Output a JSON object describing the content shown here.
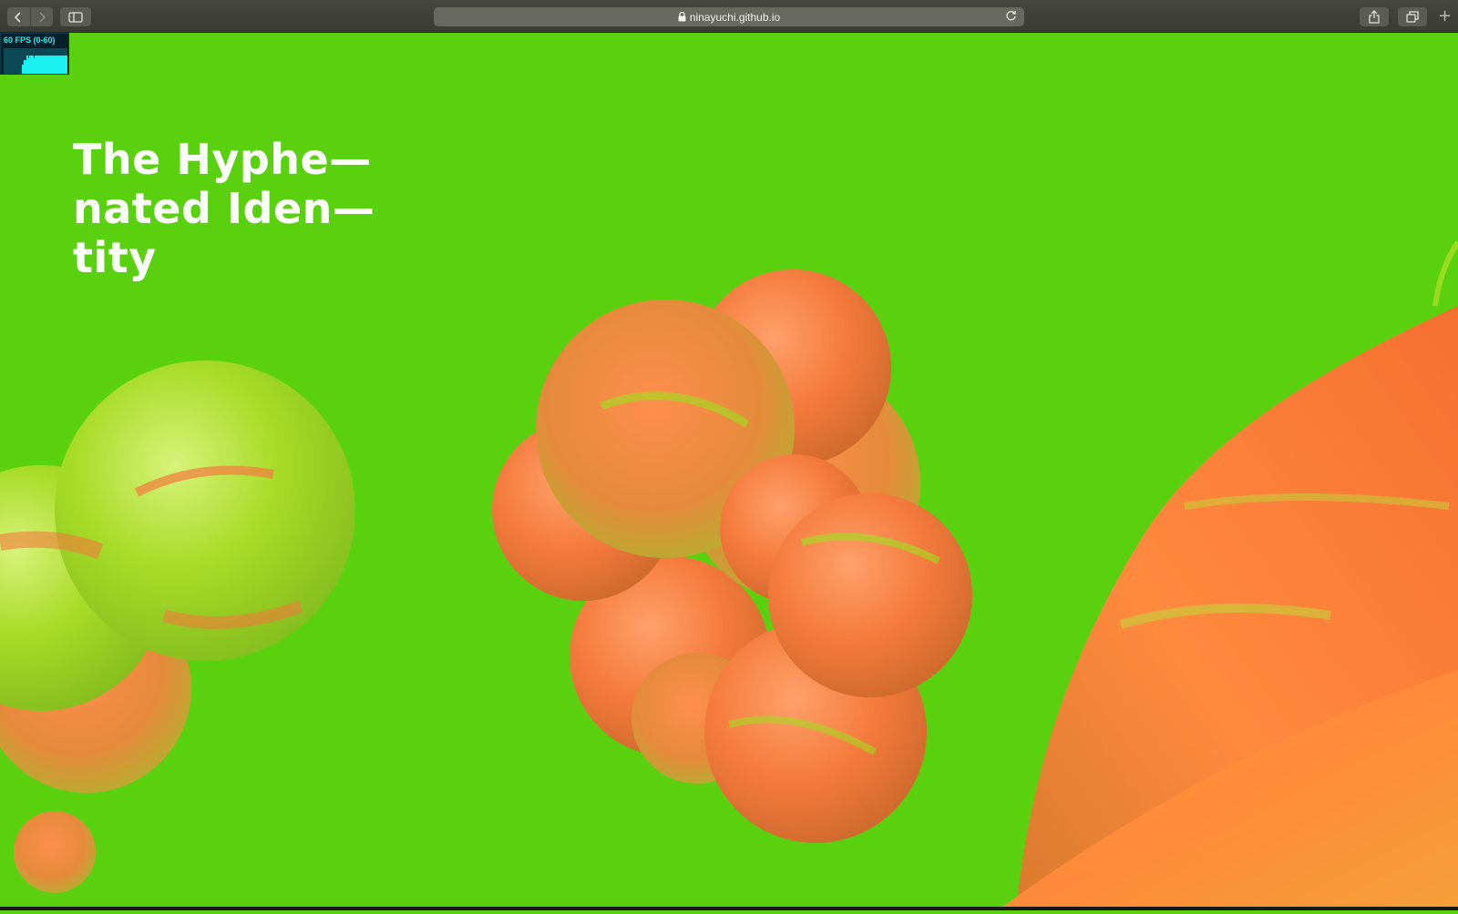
{
  "browser": {
    "url": "ninayuchi.github.io",
    "icons": [
      "back-icon",
      "forward-icon",
      "sidebar-icon",
      "lock-icon",
      "reload-icon",
      "share-icon",
      "tabs-icon",
      "new-tab-icon"
    ]
  },
  "fps_meter": {
    "label": "60 FPS (0-60)",
    "current_fps": 60,
    "range": [
      0,
      60
    ],
    "color": "#1cf0f0"
  },
  "page": {
    "headline_lines": [
      "The Hyphe—",
      "nated Iden—",
      "tity"
    ],
    "colors": {
      "background": "#5ad10f",
      "headline": "#ffffff",
      "sphere_orange": "#ff7a3a",
      "sphere_lime": "#9be21a"
    }
  }
}
